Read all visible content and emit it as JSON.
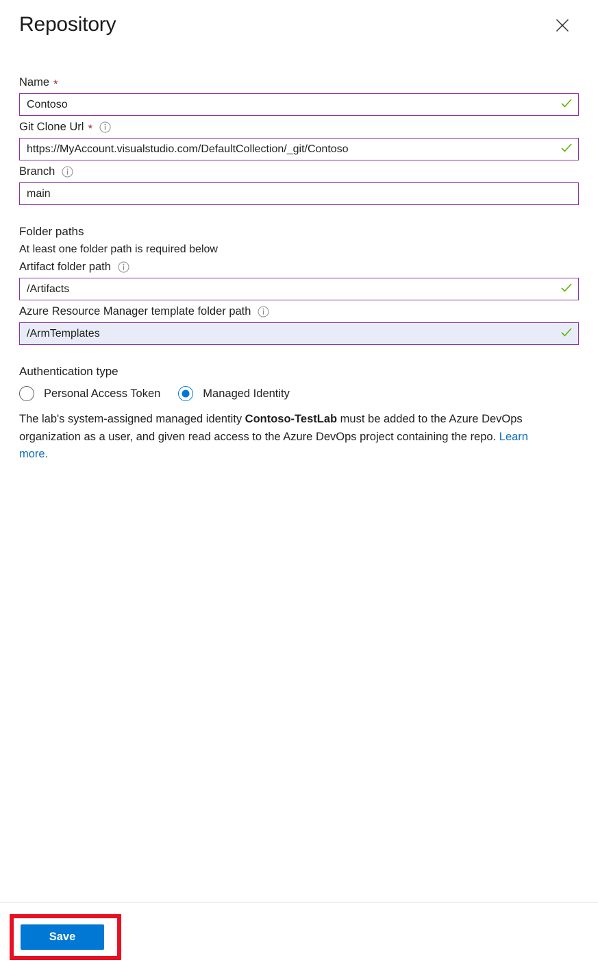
{
  "panel": {
    "title": "Repository",
    "close_label": "Close",
    "close_icon": "close-icon"
  },
  "fields": {
    "name": {
      "label": "Name",
      "required_marker": "*",
      "value": "Contoso",
      "valid": true,
      "valid_icon": "checkmark-icon"
    },
    "git_clone_url": {
      "label": "Git Clone Url",
      "required_marker": "*",
      "info_icon": "info-icon",
      "value": "https://MyAccount.visualstudio.com/DefaultCollection/_git/Contoso",
      "valid": true,
      "valid_icon": "checkmark-icon"
    },
    "branch": {
      "label": "Branch",
      "info_icon": "info-icon",
      "value": "main",
      "valid": false
    }
  },
  "folder_paths": {
    "section_title": "Folder paths",
    "helper_text": "At least one folder path is required below",
    "artifact": {
      "label": "Artifact folder path",
      "info_icon": "info-icon",
      "value": "/Artifacts",
      "valid": true,
      "valid_icon": "checkmark-icon"
    },
    "arm_template": {
      "label": "Azure Resource Manager template folder path",
      "info_icon": "info-icon",
      "value": "/ArmTemplates",
      "valid": true,
      "valid_icon": "checkmark-icon",
      "focused": true
    }
  },
  "authentication": {
    "section_title": "Authentication type",
    "options": [
      {
        "label": "Personal Access Token",
        "selected": false
      },
      {
        "label": "Managed Identity",
        "selected": true
      }
    ],
    "description": {
      "part1": "The lab's system-assigned managed identity ",
      "identity_name": "Contoso-TestLab",
      "part2": " must be added to the Azure DevOps organization as a user, and given read access to the Azure DevOps project containing the repo. ",
      "link_text": "Learn more."
    }
  },
  "footer": {
    "save_label": "Save",
    "highlight_color": "#e81123"
  },
  "colors": {
    "input_border": "#8a2fa8",
    "input_focus_background": "#e7ecf8",
    "valid_check": "#5cb300",
    "required_star": "#a4262c",
    "accent_blue": "#0078d4",
    "link_blue": "#0f6cbd",
    "annotation_red": "#e81123"
  }
}
